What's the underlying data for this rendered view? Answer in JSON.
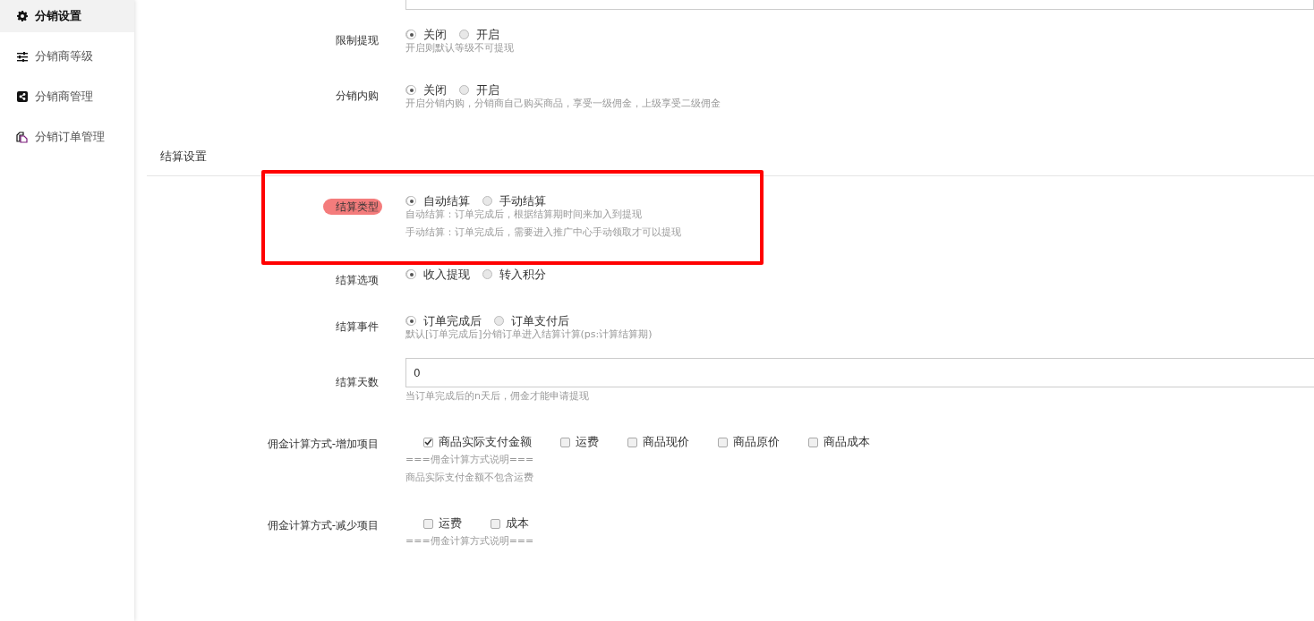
{
  "sidebar": {
    "items": [
      {
        "label": "分销设置",
        "selected": true
      },
      {
        "label": "分销商等级",
        "selected": false
      },
      {
        "label": "分销商管理",
        "selected": false
      },
      {
        "label": "分销订单管理",
        "selected": false
      }
    ]
  },
  "form": {
    "rows": [
      {
        "kind": "radio",
        "label": "限制提现",
        "options": [
          {
            "label": "关闭",
            "selected": true
          },
          {
            "label": "开启",
            "selected": false
          }
        ],
        "help": [
          "开启则默认等级不可提现"
        ]
      },
      {
        "kind": "radio",
        "label": "分销内购",
        "options": [
          {
            "label": "关闭",
            "selected": true
          },
          {
            "label": "开启",
            "selected": false
          }
        ],
        "help": [
          "开启分销内购，分销商自己购买商品，享受一级佣金，上级享受二级佣金"
        ]
      },
      {
        "kind": "section",
        "title": "结算设置"
      },
      {
        "kind": "radio",
        "label": "结算类型",
        "highlighted": true,
        "framed": true,
        "options": [
          {
            "label": "自动结算",
            "selected": true
          },
          {
            "label": "手动结算",
            "selected": false
          }
        ],
        "help": [
          "自动结算：订单完成后，根据结算期时间来加入到提现",
          "手动结算：订单完成后，需要进入推广中心手动领取才可以提现"
        ]
      },
      {
        "kind": "radio",
        "label": "结算选项",
        "options": [
          {
            "label": "收入提现",
            "selected": true
          },
          {
            "label": "转入积分",
            "selected": false
          }
        ]
      },
      {
        "kind": "radio",
        "label": "结算事件",
        "options": [
          {
            "label": "订单完成后",
            "selected": true
          },
          {
            "label": "订单支付后",
            "selected": false
          }
        ],
        "help": [
          "默认[订单完成后]分销订单进入结算计算(ps:计算结算期)"
        ]
      },
      {
        "kind": "input",
        "label": "结算天数",
        "value": "0",
        "help": [
          "当订单完成后的n天后，佣金才能申请提现"
        ]
      },
      {
        "kind": "checkbox",
        "label": "佣金计算方式-增加项目",
        "options": [
          {
            "label": "商品实际支付金额",
            "checked": true
          },
          {
            "label": "运费",
            "checked": false
          },
          {
            "label": "商品现价",
            "checked": false
          },
          {
            "label": "商品原价",
            "checked": false
          },
          {
            "label": "商品成本",
            "checked": false
          }
        ],
        "help": [
          "===佣金计算方式说明===",
          "商品实际支付金额不包含运费"
        ]
      },
      {
        "kind": "checkbox",
        "label": "佣金计算方式-减少项目",
        "options": [
          {
            "label": "运费",
            "checked": false
          },
          {
            "label": "成本",
            "checked": false
          }
        ],
        "help": [
          "===佣金计算方式说明==="
        ]
      }
    ]
  }
}
